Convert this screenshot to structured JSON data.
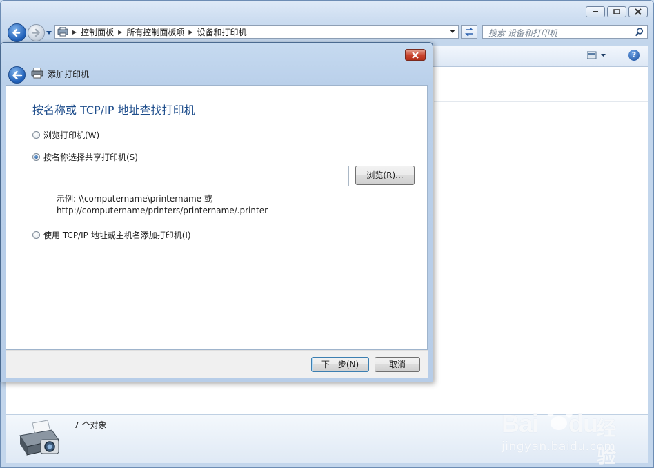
{
  "explorer": {
    "address": {
      "crumbs": [
        "控制面板",
        "所有控制面板项",
        "设备和打印机"
      ]
    },
    "search": {
      "placeholder": "搜索 设备和打印机"
    },
    "details": {
      "object_count": "7 个对象"
    }
  },
  "dialog": {
    "title": "添加打印机",
    "heading": "按名称或 TCP/IP 地址查找打印机",
    "options": [
      {
        "label": "浏览打印机(W)",
        "checked": false
      },
      {
        "label": "按名称选择共享打印机(S)",
        "checked": true
      },
      {
        "label": "使用 TCP/IP 地址或主机名添加打印机(I)",
        "checked": false
      }
    ],
    "printer_name_value": "",
    "browse_label": "浏览(R)...",
    "example_line1": "示例: \\\\computername\\printername 或",
    "example_line2": "http://computername/printers/printername/.printer",
    "next_label": "下一步(N)",
    "cancel_label": "取消"
  },
  "watermark": {
    "brand": "Bai",
    "brand_end": "du",
    "brand_cn": "经验",
    "url": "jingyan.baidu.com"
  },
  "colors": {
    "heading": "#1f4e8c",
    "frame": "#c3d6ec",
    "close": "#c8432d"
  }
}
